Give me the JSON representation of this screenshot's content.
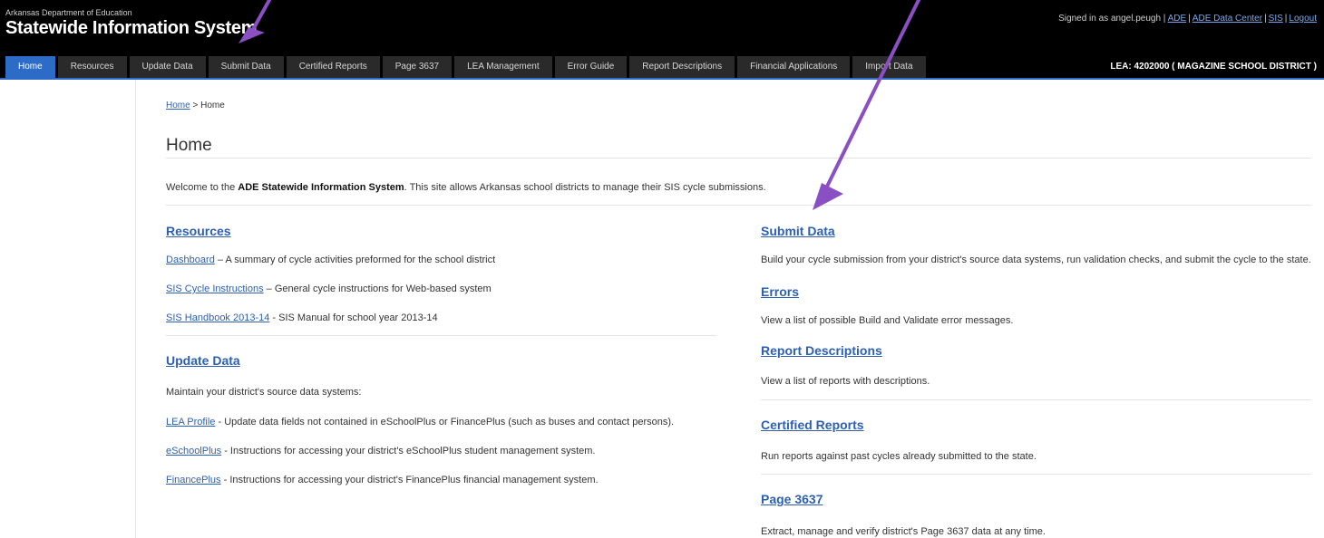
{
  "header": {
    "dept": "Arkansas Department of Education",
    "title": "Statewide Information System",
    "signed_in": "Signed in as angel.peugh |",
    "links": [
      "ADE",
      "ADE Data Center",
      "SIS",
      "Logout"
    ],
    "lea": "LEA: 4202000 ( MAGAZINE SCHOOL DISTRICT )"
  },
  "nav": {
    "tabs": [
      "Home",
      "Resources",
      "Update Data",
      "Submit Data",
      "Certified Reports",
      "Page 3637",
      "LEA Management",
      "Error Guide",
      "Report Descriptions",
      "Financial Applications",
      "Import Data"
    ],
    "active": "Home"
  },
  "breadcrumb": {
    "link": "Home",
    "sep": " > ",
    "current": "Home"
  },
  "page_title": "Home",
  "welcome": {
    "prefix": "Welcome to the ",
    "bold": "ADE Statewide Information System",
    "suffix": ". This site allows Arkansas school districts to manage their SIS cycle submissions."
  },
  "left": {
    "resources": {
      "title": "Resources",
      "items": [
        {
          "link": "Dashboard",
          "text": " – A summary of cycle activities preformed for the school district"
        },
        {
          "link": "SIS Cycle Instructions",
          "text": " – General cycle instructions for Web-based system"
        },
        {
          "link": "SIS Handbook 2013-14",
          "text": " - SIS Manual for school year 2013-14"
        }
      ]
    },
    "update": {
      "title": "Update Data",
      "intro": "Maintain your district's source data systems:",
      "items": [
        {
          "link": "LEA Profile",
          "text": " - Update data fields not contained in eSchoolPlus or FinancePlus (such as buses and contact persons)."
        },
        {
          "link": "eSchoolPlus",
          "text": " - Instructions for accessing your district's eSchoolPlus student management system."
        },
        {
          "link": "FinancePlus",
          "text": " - Instructions for accessing your district's FinancePlus financial management system."
        }
      ]
    }
  },
  "right": {
    "submit": {
      "title": "Submit Data",
      "text": "Build your cycle submission from your district's source data systems, run validation checks, and submit the cycle to the state."
    },
    "errors": {
      "title": "Errors",
      "text": "View a list of possible Build and Validate error messages."
    },
    "reports": {
      "title": "Report Descriptions",
      "text": "View a list of reports with descriptions."
    },
    "certified": {
      "title": "Certified Reports",
      "text": "Run reports against past cycles already submitted to the state."
    },
    "page3637": {
      "title": "Page 3637",
      "text": "Extract, manage and verify district's Page 3637 data at any time."
    }
  },
  "colors": {
    "header_bg": "#000000",
    "accent": "#2d6cc6",
    "link": "#2d5fb3",
    "arrow": "#8a4fc2"
  }
}
